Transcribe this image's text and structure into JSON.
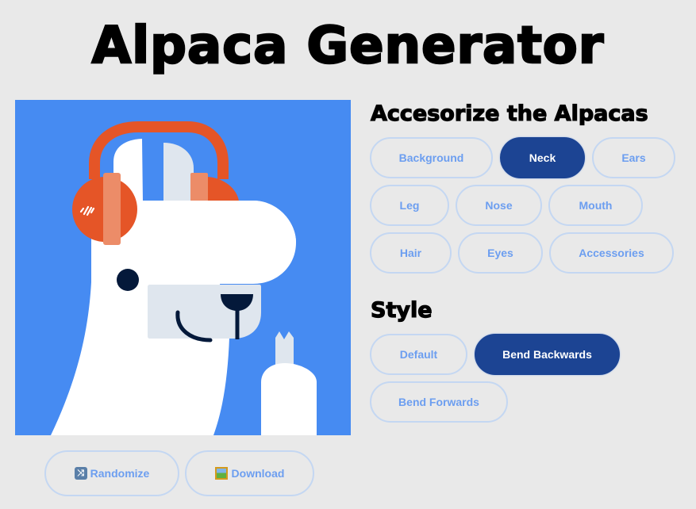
{
  "app": {
    "title": "Alpaca Generator"
  },
  "preview": {
    "colors": {
      "background": "#468bf2",
      "fur": "#ffffff",
      "fur_shade": "#dfe6ee",
      "headphones": "#e55527",
      "headphone_pads": "#ec8c68",
      "features": "#04193a"
    },
    "accessory": "headphones",
    "style": "Bend Backwards"
  },
  "accessorize": {
    "heading": "Accesorize the Alpacas",
    "options": [
      {
        "label": "Background",
        "active": false
      },
      {
        "label": "Neck",
        "active": true
      },
      {
        "label": "Ears",
        "active": false
      },
      {
        "label": "Leg",
        "active": false
      },
      {
        "label": "Nose",
        "active": false
      },
      {
        "label": "Mouth",
        "active": false
      },
      {
        "label": "Hair",
        "active": false
      },
      {
        "label": "Eyes",
        "active": false
      },
      {
        "label": "Accessories",
        "active": false
      }
    ]
  },
  "style": {
    "heading": "Style",
    "options": [
      {
        "label": "Default",
        "active": false
      },
      {
        "label": "Bend Backwards",
        "active": true
      },
      {
        "label": "Bend Forwards",
        "active": false
      }
    ]
  },
  "actions": {
    "randomize": {
      "label": "Randomize",
      "icon": "shuffle-icon"
    },
    "download": {
      "label": "Download",
      "icon": "framed-picture-icon"
    }
  },
  "theme": {
    "page_bg": "#e9e9e9",
    "active_bg": "#1c4493",
    "pill_text": "#6c9ef0",
    "pill_border": "#c4d7f2"
  }
}
